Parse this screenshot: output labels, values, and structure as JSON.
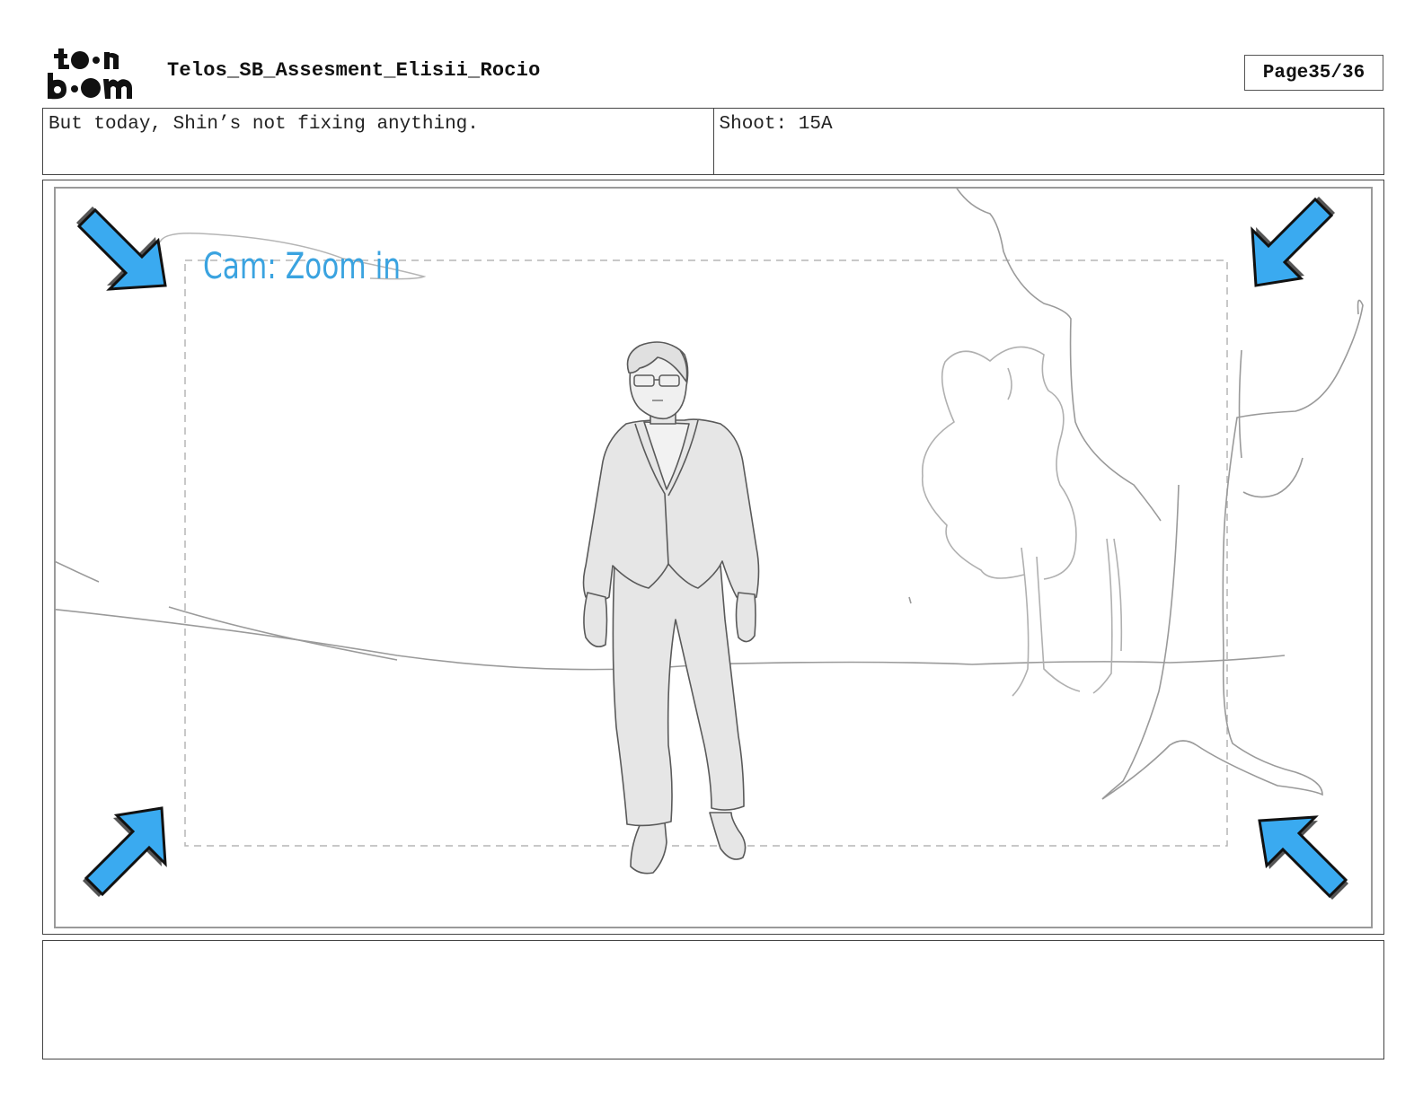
{
  "header": {
    "logo_text": "toon boom",
    "document_title": "Telos_SB_Assesment_Elisii_Rocio",
    "page_label": "Page",
    "page_number": "35/36"
  },
  "panel_info": {
    "dialogue": "But today, Shin’s not fixing anything.",
    "shot_label": "Shoot:",
    "shot_number": "15A"
  },
  "panel": {
    "camera_note": "Cam: Zoom in",
    "arrow_color": "#3aa3e0",
    "sketch_color": "#9a9a9a"
  },
  "notes": {
    "text": ""
  }
}
